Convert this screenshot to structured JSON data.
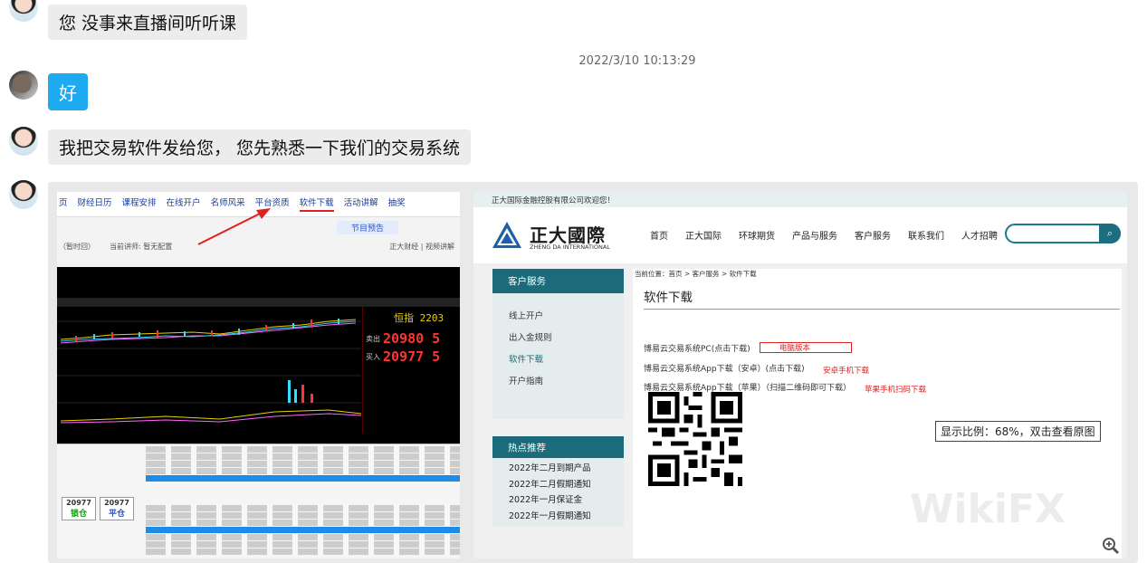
{
  "messages": [
    {
      "sender": "agent",
      "text": "您 没事来直播间听听课"
    },
    {
      "sender": "user",
      "text": "好"
    },
    {
      "sender": "agent",
      "text": "我把交易软件发给您， 您先熟悉一下我们的交易系统"
    }
  ],
  "timestamp": "2022/3/10 10:13:29",
  "screenshot": {
    "left": {
      "nav": [
        "页",
        "财经日历",
        "课程安排",
        "在线开户",
        "名师风采",
        "平台资质",
        "软件下载",
        "活动讲解",
        "抽奖"
      ],
      "program_tab": "节目预告",
      "bar_label_1": "（暂时回）",
      "bar_label_2": "当前讲师: 暂无配置",
      "bar_label_3": "正大财经 | 视频讲解",
      "quote_name": "恒指 2203",
      "sell_label": "卖出",
      "sell_price": "20980 5",
      "buy_label": "买入",
      "buy_price": "20977 5",
      "btn_sell_price": "20977",
      "btn_sell_label": "锁仓",
      "btn_buy_price": "20977",
      "btn_buy_label": "平仓"
    },
    "right": {
      "welcome": "正大国际金融控股有限公司欢迎您！",
      "logo_cn": "正大國際",
      "logo_en": "ZHENG DA INTERNATIONAL",
      "menu": [
        "首页",
        "正大国际",
        "环球期货",
        "产品与服务",
        "客户服务",
        "联系我们",
        "人才招聘"
      ],
      "sidebar_title": "客户服务",
      "sidebar_items": [
        "线上开户",
        "出入金规则",
        "软件下载",
        "开户指南"
      ],
      "hot_title": "热点推荐",
      "hot_items": [
        "2022年二月到期产品",
        "2022年二月假期通知",
        "2022年一月保证金",
        "2022年一月假期通知"
      ],
      "breadcrumb": "当前位置：首页 > 客户服务 > 软件下载",
      "page_title": "软件下载",
      "downloads": [
        {
          "label": "博易云交易系统PC(点击下载)",
          "note": "电脑版本"
        },
        {
          "label": "博易云交易系统App下载（安卓）(点击下载)",
          "note": "安卓手机下载"
        },
        {
          "label": "博易云交易系统App下载（苹果）（扫描二维码即可下载）",
          "note": "苹果手机扫码下载"
        }
      ]
    }
  },
  "ratio_tip": "显示比例：68%，双击查看原图",
  "watermark": "WikiFX",
  "colors": {
    "blue_bubble": "#1eaaf1",
    "gray_bubble": "#ececec",
    "teal": "#1b6b7a",
    "red": "#e02020"
  }
}
